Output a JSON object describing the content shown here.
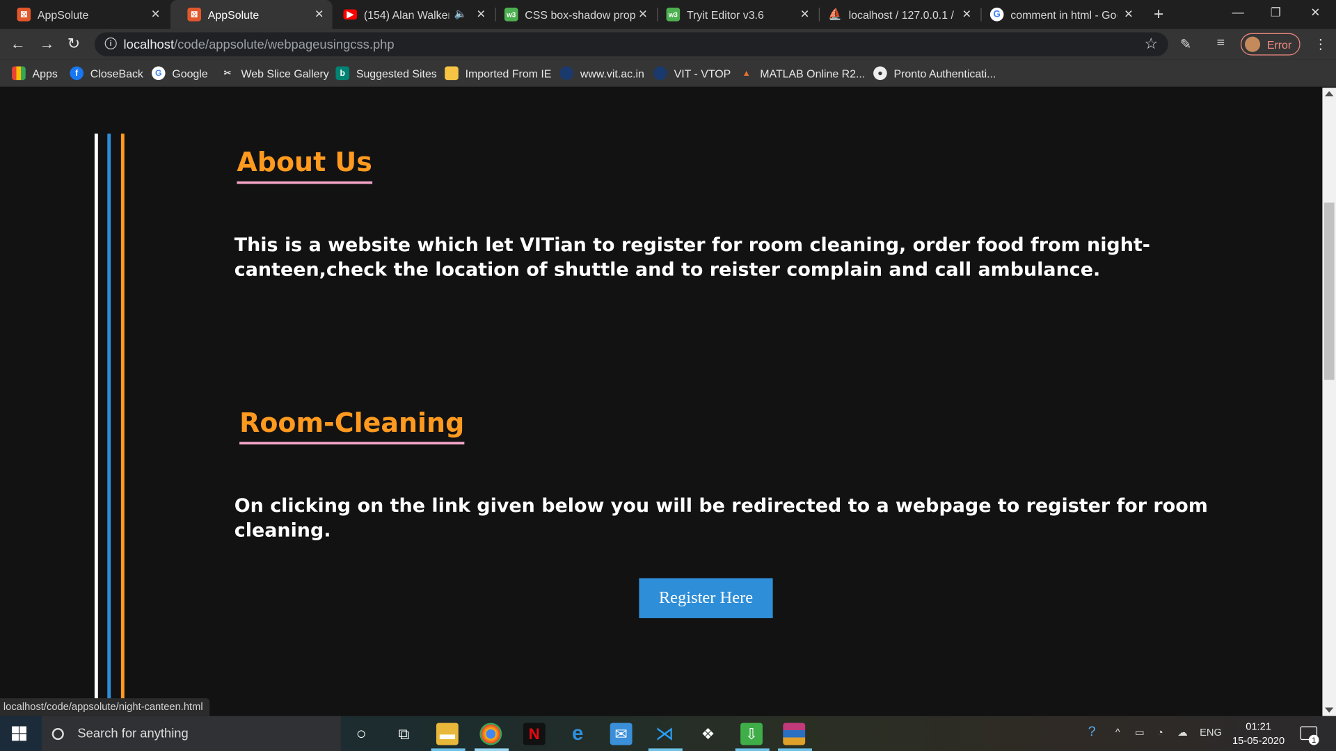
{
  "tabs": [
    {
      "title": "AppSolute",
      "active": false
    },
    {
      "title": "AppSolute",
      "active": true
    },
    {
      "title": "(154) Alan Walker",
      "active": false
    },
    {
      "title": "CSS box-shadow prope",
      "active": false
    },
    {
      "title": "Tryit Editor v3.6",
      "active": false
    },
    {
      "title": "localhost / 127.0.0.1 / s",
      "active": false
    },
    {
      "title": "comment in html - Goo",
      "active": false
    }
  ],
  "toolbar": {
    "url_host": "localhost",
    "url_path": "/code/appsolute/webpageusingcss.php",
    "profile_status": "Error"
  },
  "bookmarks": [
    "Apps",
    "CloseBack",
    "Google",
    "Web Slice Gallery",
    "Suggested Sites",
    "Imported From IE",
    "www.vit.ac.in",
    "VIT - VTOP",
    "MATLAB Online R2...",
    "Pronto Authenticati..."
  ],
  "page": {
    "about_title": "About Us",
    "about_text": "This is a website which let VITian to register for room cleaning, order food from night-canteen,check the location of shuttle and to reister complain and call ambulance.",
    "room_title": "Room-Cleaning",
    "room_text": "On clicking on the link given below you will be redirected to a webpage to register for room cleaning.",
    "register_button": "Register Here",
    "line_colors": [
      "#ffffff",
      "#2e8ed8",
      "#ff9a1f"
    ],
    "accent": "#ff9a1f"
  },
  "status_url": "localhost/code/appsolute/night-canteen.html",
  "taskbar": {
    "search_placeholder": "Search for anything",
    "language": "ENG",
    "time": "01:21",
    "date": "15-05-2020",
    "notification_count": "1"
  }
}
